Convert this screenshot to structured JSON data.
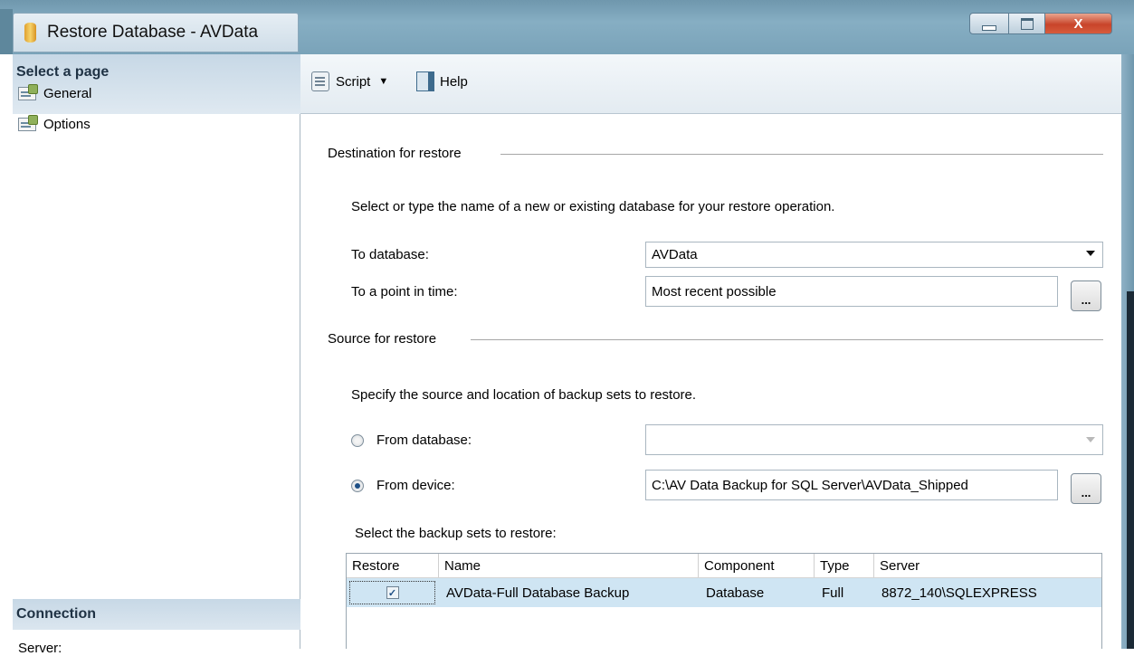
{
  "window": {
    "title": "Restore Database - AVData",
    "minimize_label": "minimize",
    "maximize_label": "maximize",
    "close_glyph": "X"
  },
  "sidebar": {
    "header": "Select a page",
    "items": [
      {
        "label": "General",
        "icon": "page-icon"
      },
      {
        "label": "Options",
        "icon": "page-icon"
      }
    ],
    "connection_header": "Connection",
    "server_label": "Server:"
  },
  "toolbar": {
    "script_label": "Script",
    "help_label": "Help"
  },
  "destination": {
    "group_title": "Destination for restore",
    "description": "Select or type the name of a new or existing database for your restore operation.",
    "to_database_label": "To database:",
    "to_database_value": "AVData",
    "point_in_time_label": "To a point in time:",
    "point_in_time_value": "Most recent possible",
    "browse_label": "..."
  },
  "source": {
    "group_title": "Source for restore",
    "description": "Specify the source and location of backup sets to restore.",
    "from_database_label": "From database:",
    "from_database_value": "",
    "from_device_label": "From device:",
    "from_device_value": "C:\\AV Data Backup for SQL Server\\AVData_Shipped",
    "browse_label": "...",
    "selected_option": "From device"
  },
  "backup_sets": {
    "label": "Select the backup sets to restore:",
    "columns": [
      "Restore",
      "Name",
      "Component",
      "Type",
      "Server"
    ],
    "rows": [
      {
        "restore": true,
        "check_glyph": "✓",
        "name": "AVData-Full Database Backup",
        "component": "Database",
        "type": "Full",
        "server": "8872_140\\SQLEXPRESS"
      }
    ]
  }
}
